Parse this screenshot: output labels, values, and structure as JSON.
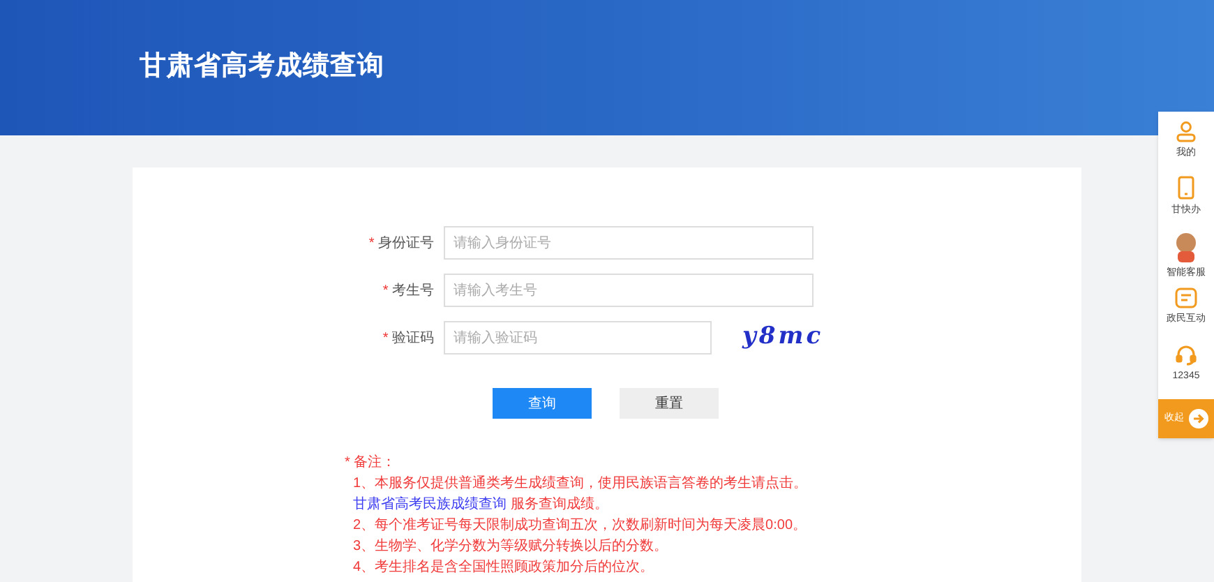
{
  "header": {
    "title": "甘肃省高考成绩查询"
  },
  "form": {
    "fields": [
      {
        "kind": "text",
        "label": "身份证号",
        "required_mark": "*",
        "placeholder": "请输入身份证号"
      },
      {
        "kind": "text",
        "label": "考生号",
        "required_mark": "*",
        "placeholder": "请输入考生号"
      },
      {
        "kind": "captcha",
        "label": "验证码",
        "required_mark": "*",
        "placeholder": "请输入验证码",
        "captcha": "y8mc"
      }
    ],
    "buttons": [
      {
        "kind": "primary",
        "label": "查询"
      },
      {
        "kind": "secondary",
        "label": "重置"
      }
    ]
  },
  "notes": {
    "mark": "*",
    "title": "备注：",
    "items": [
      {
        "text": "1、本服务仅提供普通类考生成绩查询，使用民族语言答卷的考生请点击。",
        "link": "甘肃省高考民族成绩查询",
        "after": "服务查询成绩。"
      },
      {
        "text": "2、每个准考证号每天限制成功查询五次，次数刷新时间为每天凌晨0:00。"
      },
      {
        "text": "3、生物学、化学分数为等级赋分转换以后的分数。"
      },
      {
        "text": "4、考生排名是含全国性照顾政策加分后的位次。"
      }
    ]
  },
  "sidebar": {
    "items": [
      {
        "kind": "user",
        "label": "我的"
      },
      {
        "kind": "phone",
        "label": "甘快办"
      },
      {
        "kind": "avatar",
        "label": "智能客服"
      },
      {
        "kind": "message",
        "label": "政民互动"
      },
      {
        "kind": "headset",
        "label": "12345"
      }
    ],
    "collapse": {
      "label": "收起"
    }
  }
}
